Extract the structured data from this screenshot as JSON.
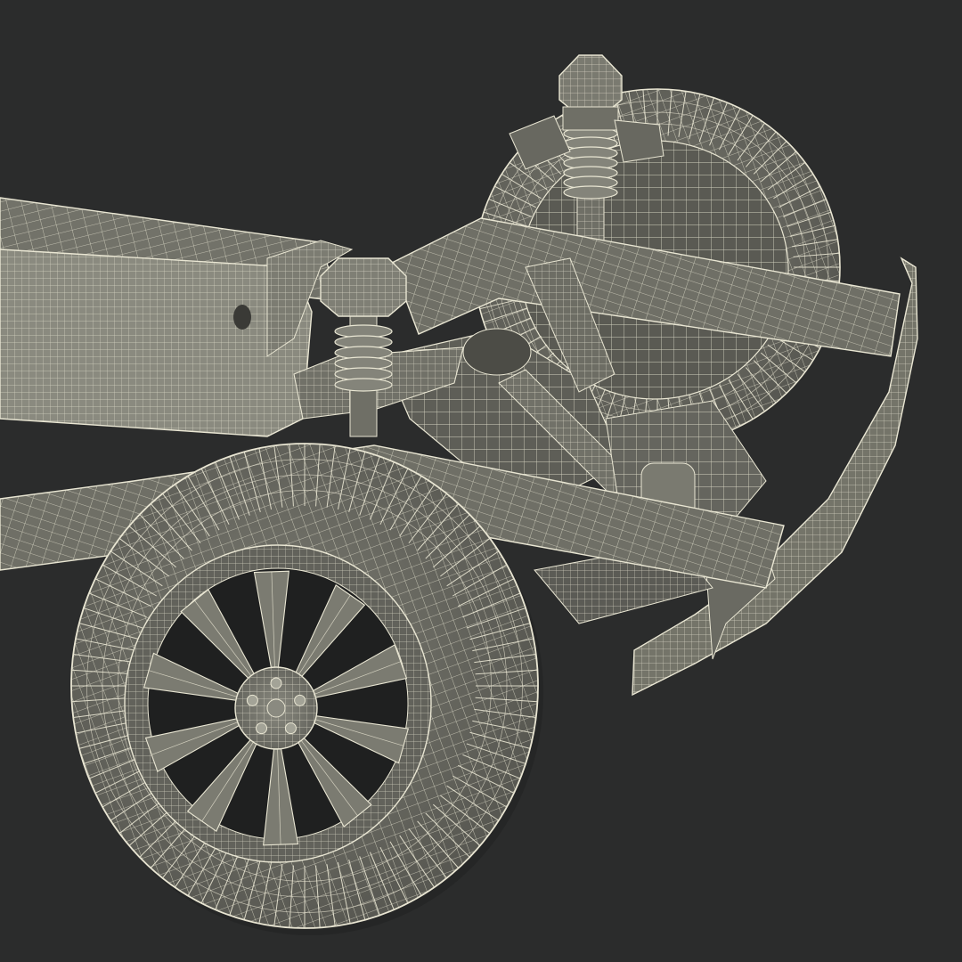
{
  "colors": {
    "background": "#2b2c2c",
    "mesh_fill": "#6f6f66",
    "mesh_fill_light": "#86867c",
    "mesh_fill_dark": "#4c4c46",
    "wire": "#e9e6d3",
    "shadow": "#1e1f1f"
  },
  "parts": {
    "front_wheel": {
      "icon": "wireframe-wheel-icon",
      "spoke_count": 10,
      "lug_count": 5
    },
    "rear_wheel": {
      "icon": "wireframe-wheel-icon"
    },
    "frame_rail": {
      "icon": "wireframe-beam-icon"
    },
    "transmission": {
      "icon": "wireframe-gearbox-icon"
    },
    "front_shock": {
      "icon": "coil-spring-icon",
      "coil_count": 6
    },
    "rear_shock": {
      "icon": "coil-spring-icon",
      "coil_count": 7
    },
    "bumper": {
      "icon": "wireframe-bumper-icon"
    },
    "differential": {
      "icon": "wireframe-differential-icon"
    }
  }
}
